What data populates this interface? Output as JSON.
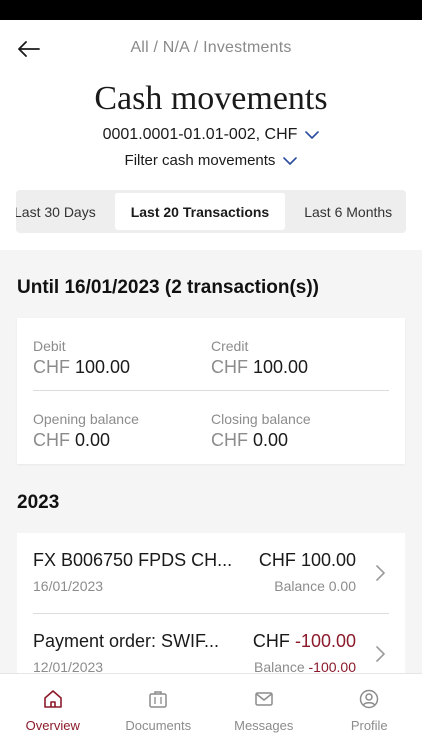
{
  "header": {
    "breadcrumb": "All / N/A / Investments",
    "title": "Cash movements",
    "account": "0001.0001-01.01-002, CHF",
    "filter_label": "Filter cash movements"
  },
  "tabs": [
    {
      "label": "Last 30 Days",
      "active": false
    },
    {
      "label": "Last 20 Transactions",
      "active": true
    },
    {
      "label": "Last 6 Months",
      "active": false
    }
  ],
  "summary": {
    "title": "Until 16/01/2023 (2 transaction(s))",
    "debit": {
      "label": "Debit",
      "currency": "CHF",
      "value": "100.00"
    },
    "credit": {
      "label": "Credit",
      "currency": "CHF",
      "value": "100.00"
    },
    "opening": {
      "label": "Opening balance",
      "currency": "CHF",
      "value": "0.00"
    },
    "closing": {
      "label": "Closing balance",
      "currency": "CHF",
      "value": "0.00"
    }
  },
  "year_section": {
    "title": "2023",
    "transactions": [
      {
        "name": "FX B006750 FPDS CH...",
        "currency": "CHF",
        "amount": "100.00",
        "date": "16/01/2023",
        "balance_label": "Balance",
        "balance": "0.00"
      },
      {
        "name": "Payment order: SWIF...",
        "currency": "CHF",
        "amount": "-100.00",
        "date": "12/01/2023",
        "balance_label": "Balance",
        "balance": "-100.00"
      }
    ]
  },
  "nav": {
    "overview": "Overview",
    "documents": "Documents",
    "messages": "Messages",
    "profile": "Profile"
  },
  "colors": {
    "accent": "#8b1a2b",
    "muted": "#8c8c8c"
  }
}
